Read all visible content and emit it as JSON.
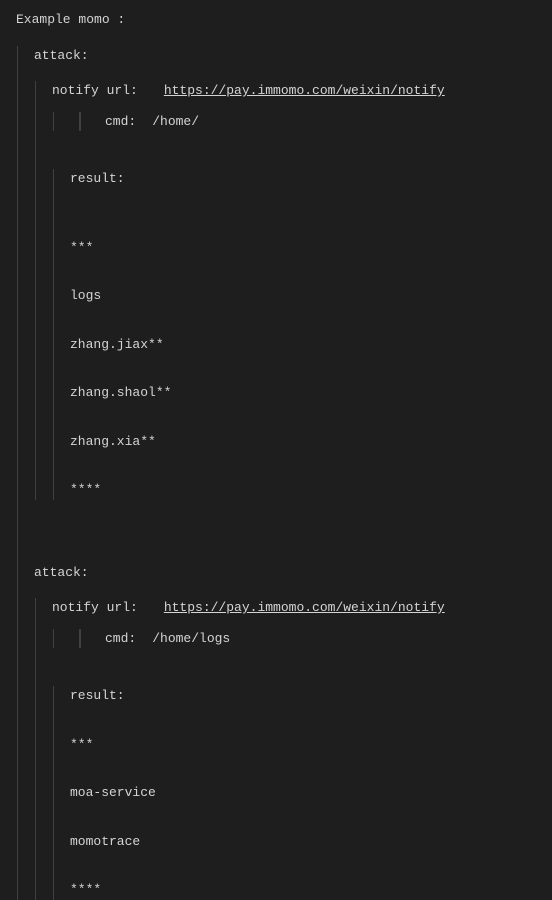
{
  "header": "Example  momo :",
  "attacks": [
    {
      "label": "attack:",
      "notify_label": "notify url:",
      "notify_url": "https://pay.immomo.com/weixin/notify",
      "cmd_label": "cmd:",
      "cmd_value": "/home/",
      "result_label": "result:",
      "lines": [
        "***",
        "logs",
        "zhang.jiax**",
        "zhang.shaol**",
        "zhang.xia**",
        "****"
      ]
    },
    {
      "label": "attack:",
      "notify_label": "notify url:",
      "notify_url": "https://pay.immomo.com/weixin/notify",
      "cmd_label": "cmd:",
      "cmd_value": "/home/logs",
      "result_label": "result:",
      "lines": [
        "***",
        " moa-service",
        " momotrace",
        " ****"
      ]
    }
  ]
}
